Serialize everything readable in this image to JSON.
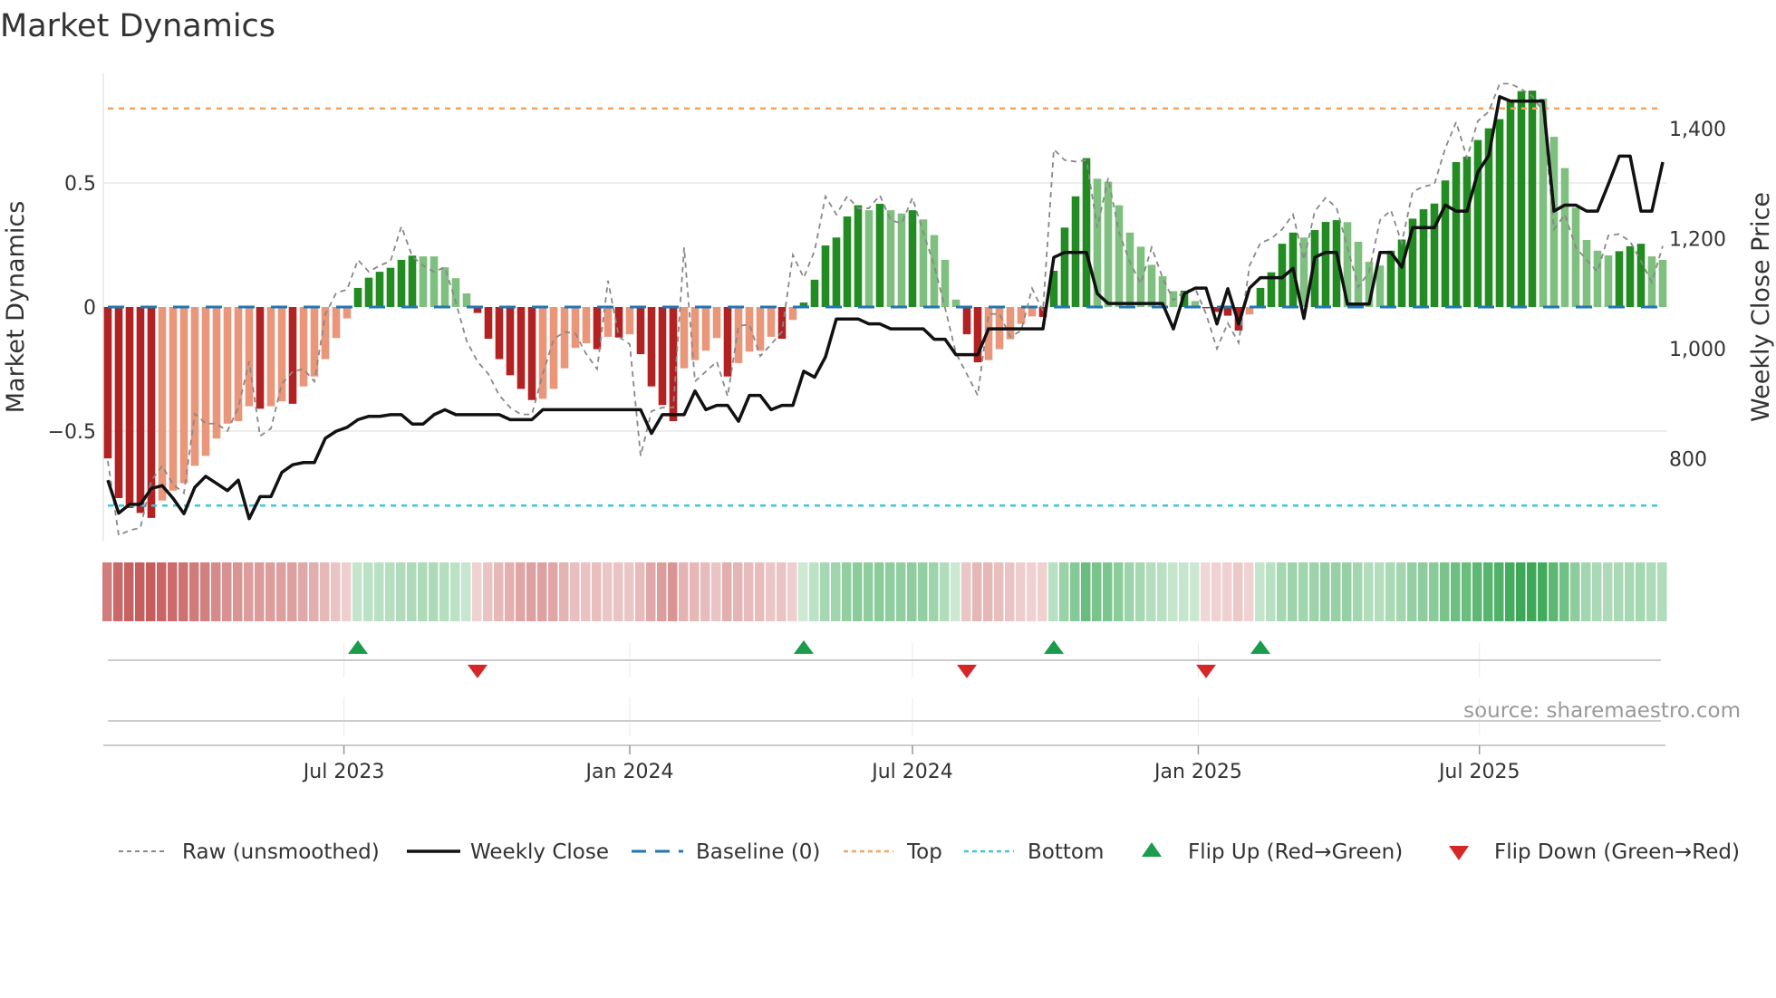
{
  "chart_data": {
    "type": "bar",
    "title": "Market Dynamics",
    "ylabel": "Market Dynamics",
    "ylabel_right": "Weekly Close Price",
    "source": "source: sharemaestro.com",
    "x_start": "2023-01-30",
    "x_frequency": "weekly",
    "ylim": [
      -0.93,
      0.95
    ],
    "ylim_right": [
      640,
      1500
    ],
    "y_ticks": [
      {
        "value": 0.5,
        "label": "0.5"
      },
      {
        "value": 0,
        "label": "0"
      },
      {
        "value": -0.5,
        "label": "−0.5"
      }
    ],
    "y_ticks_right": [
      {
        "value": 1400,
        "label": "1,400"
      },
      {
        "value": 1200,
        "label": "1,200"
      },
      {
        "value": 1000,
        "label": "1,000"
      },
      {
        "value": 800,
        "label": "800"
      }
    ],
    "x_ticks": [
      {
        "date": "2023-07-01",
        "label": "Jul 2023"
      },
      {
        "date": "2024-01-01",
        "label": "Jan 2024"
      },
      {
        "date": "2024-07-01",
        "label": "Jul 2024"
      },
      {
        "date": "2025-01-01",
        "label": "Jan 2025"
      },
      {
        "date": "2025-07-01",
        "label": "Jul 2025"
      }
    ],
    "reference_lines": {
      "baseline": 0,
      "top": 0.8,
      "bottom": -0.8
    },
    "colors": {
      "red_strong": "#b22222",
      "red_weak": "#e9967a",
      "green_strong": "#228b22",
      "green_weak": "#7fbf7f",
      "baseline": "#1f77b4",
      "top": "#f4a460",
      "bottom": "#3cc8dc",
      "raw": "#888888",
      "close": "#111111",
      "flip_up": "#1a9c4a",
      "flip_down": "#d62728"
    },
    "series": [
      {
        "name": "Market Dynamics (smoothed)",
        "values": [
          -0.61,
          -0.77,
          -0.81,
          -0.83,
          -0.85,
          -0.78,
          -0.74,
          -0.71,
          -0.64,
          -0.6,
          -0.53,
          -0.47,
          -0.46,
          -0.4,
          -0.41,
          -0.4,
          -0.38,
          -0.39,
          -0.32,
          -0.28,
          -0.21,
          -0.125,
          -0.046,
          0.077,
          0.118,
          0.142,
          0.158,
          0.19,
          0.207,
          0.204,
          0.204,
          0.16,
          0.116,
          0.055,
          -0.024,
          -0.128,
          -0.21,
          -0.275,
          -0.33,
          -0.375,
          -0.37,
          -0.33,
          -0.247,
          -0.165,
          -0.146,
          -0.17,
          -0.12,
          -0.123,
          -0.11,
          -0.19,
          -0.32,
          -0.395,
          -0.46,
          -0.247,
          -0.214,
          -0.176,
          -0.125,
          -0.28,
          -0.226,
          -0.18,
          -0.176,
          -0.12,
          -0.128,
          -0.052,
          0.018,
          0.11,
          0.248,
          0.28,
          0.365,
          0.41,
          0.39,
          0.416,
          0.39,
          0.377,
          0.39,
          0.353,
          0.29,
          0.19,
          0.03,
          -0.11,
          -0.223,
          -0.214,
          -0.17,
          -0.13,
          -0.068,
          -0.038,
          -0.04,
          0.146,
          0.32,
          0.446,
          0.6,
          0.517,
          0.505,
          0.41,
          0.3,
          0.243,
          0.17,
          0.124,
          0.064,
          0.066,
          0.024,
          -0.005,
          -0.02,
          -0.035,
          -0.095,
          -0.03,
          0.077,
          0.14,
          0.255,
          0.3,
          0.28,
          0.31,
          0.343,
          0.35,
          0.342,
          0.263,
          0.182,
          0.167,
          0.227,
          0.272,
          0.356,
          0.394,
          0.417,
          0.51,
          0.584,
          0.606,
          0.673,
          0.72,
          0.757,
          0.83,
          0.87,
          0.872,
          0.84,
          0.686,
          0.56,
          0.4,
          0.27,
          0.227,
          0.208,
          0.225,
          0.245,
          0.255,
          0.204,
          0.19
        ]
      },
      {
        "name": "Raw (unsmoothed)",
        "values": [
          -0.62,
          -0.92,
          -0.9,
          -0.89,
          -0.7,
          -0.64,
          -0.715,
          -0.75,
          -0.43,
          -0.47,
          -0.47,
          -0.5,
          -0.405,
          -0.22,
          -0.52,
          -0.49,
          -0.31,
          -0.26,
          -0.25,
          -0.3,
          -0.03,
          0.057,
          0.07,
          0.19,
          0.142,
          0.167,
          0.185,
          0.325,
          0.203,
          0.167,
          0.142,
          0.16,
          0.02,
          -0.137,
          -0.22,
          -0.27,
          -0.356,
          -0.405,
          -0.433,
          -0.433,
          -0.27,
          -0.13,
          -0.1,
          -0.107,
          -0.19,
          -0.25,
          0.106,
          -0.12,
          -0.15,
          -0.6,
          -0.42,
          -0.405,
          -0.405,
          0.24,
          -0.3,
          -0.26,
          -0.22,
          -0.36,
          -0.077,
          -0.07,
          -0.198,
          -0.15,
          -0.1,
          0.21,
          0.118,
          0.227,
          0.446,
          0.373,
          0.446,
          0.398,
          0.398,
          0.45,
          0.35,
          0.337,
          0.44,
          0.3,
          0.167,
          -0.004,
          -0.186,
          -0.27,
          -0.356,
          -0.028,
          -0.028,
          -0.12,
          -0.095,
          0.075,
          -0.016,
          0.635,
          0.592,
          0.586,
          0.592,
          0.32,
          0.52,
          0.3,
          0.18,
          0.094,
          0.24,
          0.118,
          0.027,
          0.063,
          0.075,
          -0.028,
          -0.168,
          -0.065,
          -0.144,
          0.167,
          0.258,
          0.276,
          0.313,
          0.373,
          0.19,
          0.386,
          0.44,
          0.4,
          0.24,
          0.08,
          0.142,
          0.35,
          0.39,
          0.258,
          0.465,
          0.485,
          0.495,
          0.64,
          0.745,
          0.6,
          0.75,
          0.787,
          0.9,
          0.9,
          0.878,
          0.85,
          0.787,
          0.313,
          0.373,
          0.24,
          0.19,
          0.142,
          0.288,
          0.294,
          0.264,
          0.185,
          0.1,
          0.246
        ]
      },
      {
        "name": "Weekly Close",
        "axis": "right",
        "values": [
          761,
          701,
          717,
          717,
          746,
          751,
          728,
          700,
          748,
          768,
          755,
          742,
          761,
          691,
          731,
          731,
          775,
          789,
          793,
          793,
          837,
          850,
          857,
          871,
          877,
          877,
          880,
          880,
          863,
          863,
          880,
          889,
          880,
          880,
          880,
          880,
          880,
          871,
          871,
          871,
          889,
          889,
          889,
          889,
          889,
          889,
          889,
          889,
          889,
          889,
          846,
          880,
          880,
          880,
          923,
          889,
          897,
          897,
          868,
          915,
          915,
          889,
          897,
          897,
          959,
          948,
          985,
          1054,
          1054,
          1054,
          1045,
          1045,
          1036,
          1036,
          1036,
          1036,
          1017,
          1017,
          989,
          989,
          989,
          1036,
          1036,
          1036,
          1036,
          1036,
          1036,
          1166,
          1175,
          1175,
          1175,
          1100,
          1082,
          1082,
          1082,
          1082,
          1082,
          1082,
          1036,
          1100,
          1110,
          1110,
          1045,
          1109,
          1045,
          1110,
          1129,
          1129,
          1129,
          1146,
          1055,
          1166,
          1175,
          1175,
          1081,
          1081,
          1081,
          1175,
          1175,
          1148,
          1220,
          1220,
          1220,
          1261,
          1250,
          1250,
          1321,
          1351,
          1458,
          1450,
          1450,
          1450,
          1450,
          1250,
          1261,
          1261,
          1250,
          1250,
          1299,
          1350,
          1350,
          1250,
          1250,
          1339
        ]
      }
    ],
    "flips": [
      {
        "week": 24,
        "type": "up"
      },
      {
        "week": 35,
        "type": "down"
      },
      {
        "week": 65,
        "type": "up"
      },
      {
        "week": 80,
        "type": "down"
      },
      {
        "week": 88,
        "type": "up"
      },
      {
        "week": 102,
        "type": "down"
      },
      {
        "week": 107,
        "type": "up"
      }
    ],
    "legend": {
      "placement": "bottom",
      "items": [
        {
          "key": "raw",
          "label": "Raw (unsmoothed)"
        },
        {
          "key": "close",
          "label": "Weekly Close"
        },
        {
          "key": "baseline",
          "label": "Baseline (0)"
        },
        {
          "key": "top",
          "label": "Top"
        },
        {
          "key": "bottom",
          "label": "Bottom"
        },
        {
          "key": "flip_up",
          "label": "Flip Up (Red→Green)"
        },
        {
          "key": "flip_down",
          "label": "Flip Down (Green→Red)"
        }
      ]
    }
  }
}
